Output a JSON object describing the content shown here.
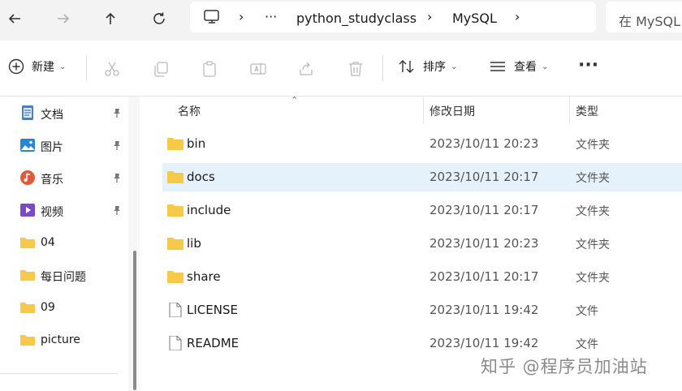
{
  "breadcrumb": {
    "ellipsis": "···",
    "sep": "›",
    "items": [
      "python_studyclass",
      "MySQL"
    ]
  },
  "search": {
    "text": "在 MySQL"
  },
  "toolbar": {
    "new_label": "新建",
    "sort_label": "排序",
    "view_label": "查看",
    "more_label": "···",
    "caret": "⌄"
  },
  "sidebar": {
    "pin": "📌",
    "items": [
      {
        "label": "文档",
        "icon": "document-icon",
        "pinned": true
      },
      {
        "label": "图片",
        "icon": "pictures-icon",
        "pinned": true
      },
      {
        "label": "音乐",
        "icon": "music-icon",
        "pinned": true
      },
      {
        "label": "视频",
        "icon": "video-icon",
        "pinned": true
      },
      {
        "label": "04",
        "icon": "folder-icon",
        "pinned": false
      },
      {
        "label": "每日问题",
        "icon": "folder-icon",
        "pinned": false
      },
      {
        "label": "09",
        "icon": "folder-icon",
        "pinned": false
      },
      {
        "label": "picture",
        "icon": "folder-icon",
        "pinned": false
      }
    ]
  },
  "filelist": {
    "columns": {
      "name": "名称",
      "modified": "修改日期",
      "type": "类型"
    },
    "sort_arrow": "⌃",
    "rows": [
      {
        "name": "bin",
        "date": "2023/10/11 20:23",
        "type": "文件夹",
        "kind": "folder"
      },
      {
        "name": "docs",
        "date": "2023/10/11 20:17",
        "type": "文件夹",
        "kind": "folder",
        "selected": true
      },
      {
        "name": "include",
        "date": "2023/10/11 20:17",
        "type": "文件夹",
        "kind": "folder"
      },
      {
        "name": "lib",
        "date": "2023/10/11 20:23",
        "type": "文件夹",
        "kind": "folder"
      },
      {
        "name": "share",
        "date": "2023/10/11 20:17",
        "type": "文件夹",
        "kind": "folder"
      },
      {
        "name": "LICENSE",
        "date": "2023/10/11 19:42",
        "type": "文件",
        "kind": "file"
      },
      {
        "name": "README",
        "date": "2023/10/11 19:42",
        "type": "文件",
        "kind": "file"
      }
    ]
  },
  "watermark": "知乎 @程序员加油站",
  "colors": {
    "folder": "#f7c948",
    "selection": "#e5f1fb",
    "accent": "#0078d4"
  }
}
